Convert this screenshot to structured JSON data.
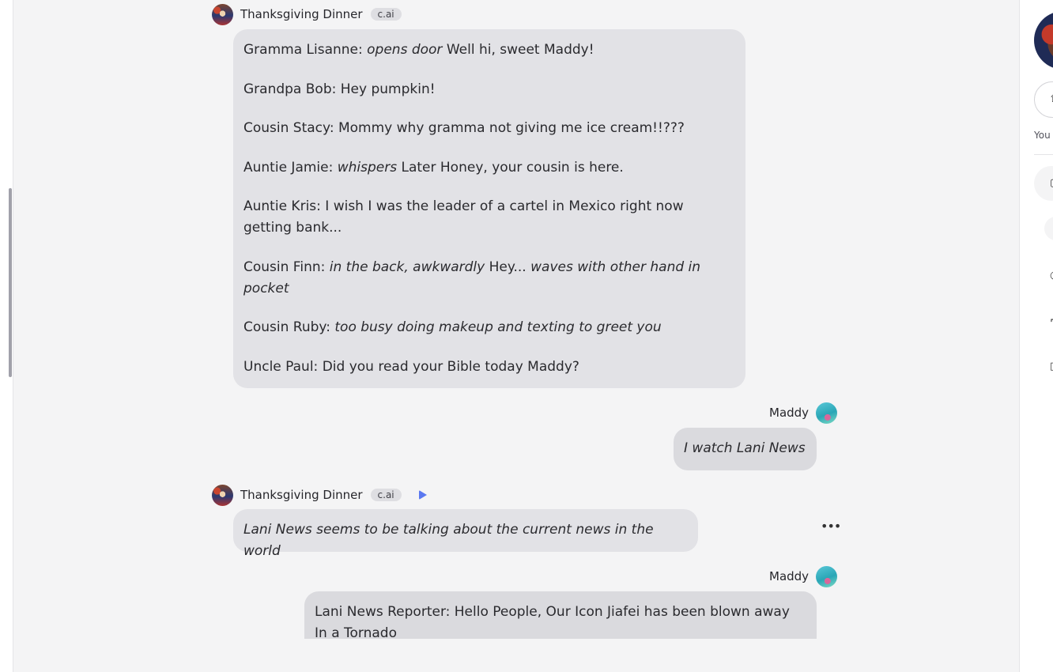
{
  "character": {
    "name": "Thanksgiving Dinner",
    "badge": "c.ai"
  },
  "user": {
    "name": "Maddy"
  },
  "sidebar": {
    "visible_label": "You"
  },
  "messages": [
    {
      "lines": [
        {
          "speaker": "Gramma Lisanne: ",
          "action": "opens door",
          "text": " Well hi, sweet Maddy!"
        },
        {
          "speaker": "Grandpa Bob: ",
          "text": "Hey pumpkin!"
        },
        {
          "speaker": "Cousin Stacy: ",
          "text": "Mommy why gramma not giving me ice cream!!???"
        },
        {
          "speaker": "Auntie Jamie: ",
          "action": "whispers",
          "text": " Later Honey, your cousin is here."
        },
        {
          "speaker": "Auntie Kris: ",
          "text": "I wish I was the leader of a cartel in Mexico right now getting bank..."
        },
        {
          "speaker": "Cousin Finn: ",
          "action": "in the back, awkwardly",
          "text": " Hey... ",
          "action2": "waves with other hand in pocket"
        },
        {
          "speaker": "Cousin Ruby: ",
          "action": "too busy doing makeup and texting to greet you"
        },
        {
          "speaker": "Uncle Paul: ",
          "text": "Did you read your Bible today Maddy?"
        }
      ]
    },
    {
      "text": "I watch Lani News"
    },
    {
      "text": "Lani News seems to be talking about the current news in the world"
    },
    {
      "text": "Lani News Reporter: Hello People, Our Icon Jiafei has been blown away In a Tornado"
    }
  ]
}
